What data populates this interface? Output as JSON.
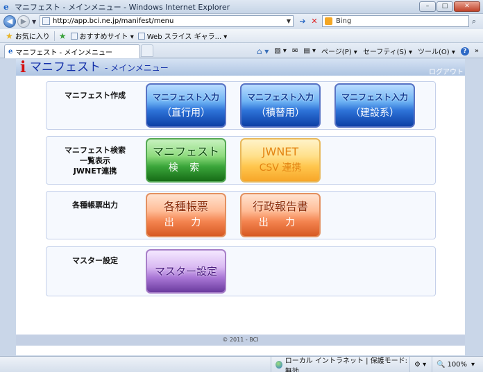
{
  "window": {
    "title": "マニフェスト - メインメニュー - Windows Internet Explorer",
    "minimize": "–",
    "maximize": "□",
    "close": "✕"
  },
  "address": {
    "url": "http://app.bci.ne.jp/manifest/menu",
    "search_placeholder": "Bing"
  },
  "favorites": {
    "label": "お気に入り",
    "items": [
      "おすすめサイト ▾",
      "Web スライス ギャラ... ▾"
    ]
  },
  "tab": {
    "title": "マニフェスト - メインメニュー"
  },
  "commands": {
    "page": "ページ(P) ▾",
    "safety": "セーフティ(S) ▾",
    "tools": "ツール(O) ▾",
    "help": "?"
  },
  "header": {
    "mark": "i",
    "title": "マニフェスト",
    "subtitle": "- メインメニュー",
    "logout": "ログアウト"
  },
  "rows": [
    {
      "label": "マニフェスト作成",
      "buttons": [
        {
          "line1": "マニフェスト入力",
          "line2": "（直行用）"
        },
        {
          "line1": "マニフェスト入力",
          "line2": "（積替用）"
        },
        {
          "line1": "マニフェスト入力",
          "line2": "（建設系）"
        }
      ]
    },
    {
      "label": "マニフェスト検索\n一覧表示\nJWNET連携",
      "buttons": [
        {
          "line1": "マニフェスト",
          "line2": "検 索"
        },
        {
          "line1": "JWNET",
          "line2": "CSV 連携"
        }
      ]
    },
    {
      "label": "各種帳票出力",
      "buttons": [
        {
          "line1": "各種帳票",
          "line2": "出 力"
        },
        {
          "line1": "行政報告書",
          "line2": "出 力"
        }
      ]
    },
    {
      "label": "マスター設定",
      "buttons": [
        {
          "line1": "マスター設定"
        }
      ]
    }
  ],
  "footer": {
    "copyright": "© 2011 - BCI"
  },
  "status": {
    "zone": "ローカル イントラネット | 保護モード: 無効",
    "zoom": "100%"
  },
  "colors": {
    "header_title": "#1330a9",
    "mark_red": "#d41212",
    "blue_btn": "#2e73d8",
    "green_btn": "#3aa53a",
    "yellow_btn": "#ffc64d",
    "orange_btn": "#f48450",
    "purple_btn": "#a977d6"
  }
}
